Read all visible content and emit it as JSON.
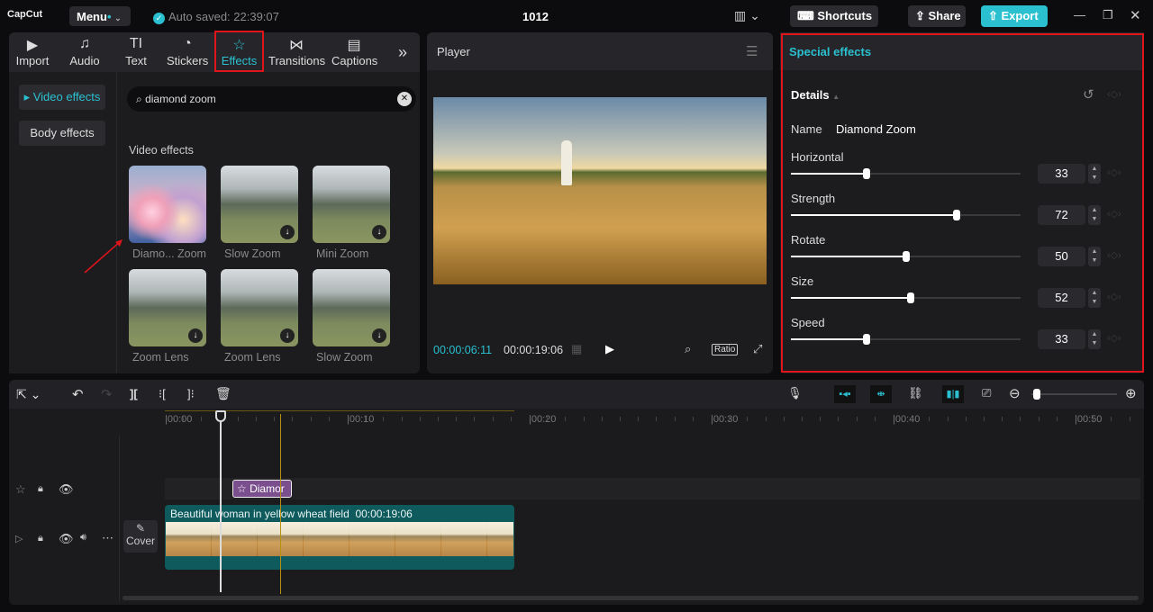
{
  "app": {
    "logo": "CapCut",
    "menu": "Menu",
    "autosaved": "Auto saved: 22:39:07",
    "project_title": "1012",
    "shortcuts": "Shortcuts",
    "share": "Share",
    "export": "Export"
  },
  "tabs": [
    {
      "label": "Import",
      "icon": "▶"
    },
    {
      "label": "Audio",
      "icon": "♫"
    },
    {
      "label": "Text",
      "icon": "TI"
    },
    {
      "label": "Stickers",
      "icon": "◔"
    },
    {
      "label": "Effects",
      "icon": "☆"
    },
    {
      "label": "Transitions",
      "icon": "⋈"
    },
    {
      "label": "Captions",
      "icon": "▤"
    }
  ],
  "sidebar": {
    "items": [
      {
        "label": "▸ Video effects"
      },
      {
        "label": "Body effects"
      }
    ]
  },
  "search": {
    "value": "diamond zoom"
  },
  "effects": {
    "section": "Video effects",
    "items": [
      {
        "label": "Diamo... Zoom"
      },
      {
        "label": "Slow Zoom"
      },
      {
        "label": "Mini Zoom"
      },
      {
        "label": "Zoom Lens"
      },
      {
        "label": "Zoom Lens"
      },
      {
        "label": "Slow Zoom"
      }
    ]
  },
  "player": {
    "title": "Player",
    "current_time": "00:00:06:11",
    "total_time": "00:00:19:06",
    "ratio": "Ratio"
  },
  "special": {
    "title": "Special effects",
    "details": "Details",
    "name_label": "Name",
    "name_value": "Diamond Zoom",
    "params": [
      {
        "label": "Horizontal",
        "value": 33
      },
      {
        "label": "Strength",
        "value": 72
      },
      {
        "label": "Rotate",
        "value": 50
      },
      {
        "label": "Size",
        "value": 52
      },
      {
        "label": "Speed",
        "value": 33
      }
    ]
  },
  "timeline": {
    "ticks": [
      "00:00",
      "00:10",
      "00:20",
      "00:30",
      "00:40",
      "00:50"
    ],
    "effect_clip": "Diamor",
    "video_clip_title": "Beautiful woman in yellow wheat field",
    "video_clip_duration": "00:00:19:06",
    "cover": "Cover",
    "zoom_level": 0.03
  },
  "colors": {
    "accent": "#2ac0d0",
    "highlight": "#e0141b",
    "effect_clip": "#7b4e8e",
    "video_clip": "#0f5a5c"
  }
}
